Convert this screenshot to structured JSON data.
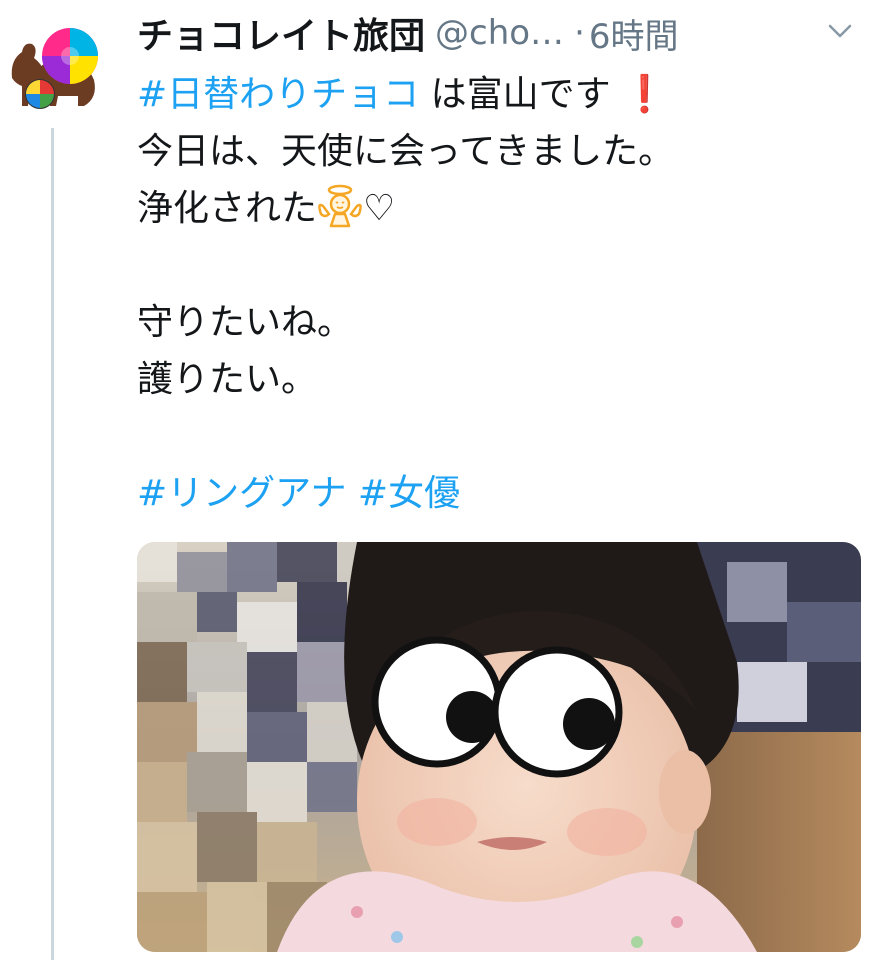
{
  "tweet": {
    "author_name": "チョコレイト旅団",
    "handle": "@cho…",
    "separator": "·",
    "time": "6時間",
    "lines": [
      {
        "tag": "#日替わりチョコ",
        "text": " は富山です",
        "emoji": "❗"
      },
      {
        "text": "今日は、天使に会ってきました。"
      },
      {
        "text": "浄化された",
        "emoji": "😇",
        "suffix": "♡"
      },
      {
        "text": "守りたいね。"
      },
      {
        "text": "護りたい。"
      }
    ],
    "hashtags": [
      "#リングアナ",
      "#女優"
    ]
  },
  "icons": {
    "avatar": "chocolate-camel-logo",
    "caret": "chevron-down-icon",
    "photo": "baby-photo-with-googly-eyes"
  },
  "colors": {
    "link": "#1da1f2",
    "text": "#14171a",
    "secondary": "#657786",
    "thread_line": "#ccd6dd",
    "exclamation": "#e0245e"
  }
}
